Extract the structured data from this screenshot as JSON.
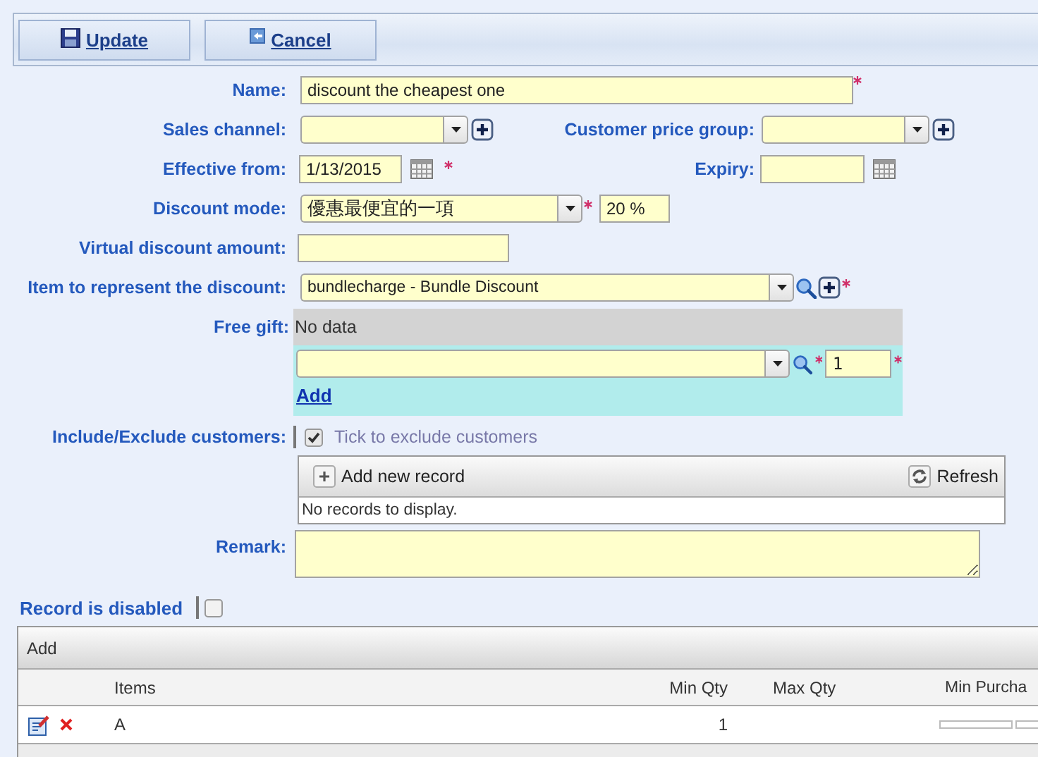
{
  "toolbar": {
    "buttons": [
      {
        "label": "Update",
        "kind": "save"
      },
      {
        "label": "Cancel",
        "kind": "cancel"
      }
    ]
  },
  "form": {
    "name": {
      "label": "Name:",
      "value": "discount the cheapest one",
      "required": true
    },
    "sales_channel": {
      "label": "Sales channel:"
    },
    "customer_price_group": {
      "label": "Customer price group:"
    },
    "effective_from": {
      "label": "Effective from:",
      "value": "1/13/2015",
      "required": true
    },
    "expiry": {
      "label": "Expiry:"
    },
    "discount_mode": {
      "label": "Discount mode:",
      "value": "優惠最便宜的一項",
      "required": true,
      "percent": "20 %"
    },
    "virtual_discount_amount": {
      "label": "Virtual discount amount:"
    },
    "item": {
      "label": "Item to represent the discount:",
      "value": "bundlecharge - Bundle Discount",
      "required": true
    },
    "free_gift": {
      "label": "Free gift:",
      "empty_text": "No data",
      "item_required": true,
      "quantity": "1",
      "quantity_required": true,
      "add_link": "Add"
    },
    "include_exclude": {
      "label": "Include/Exclude customers:",
      "checked": true,
      "option": "Tick to exclude customers",
      "grid": {
        "add_button": "Add new record",
        "refresh_button": "Refresh",
        "empty_text": "No records to display."
      }
    },
    "remark": {
      "label": "Remark:"
    }
  },
  "record_disabled": {
    "label": "Record is disabled",
    "checked": false
  },
  "items_grid": {
    "add_button": "Add",
    "columns": [
      "Items",
      "Min Qty",
      "Max Qty",
      "Min Purcha"
    ],
    "rows": [
      {
        "items": "A",
        "min_qty": "1"
      }
    ]
  }
}
